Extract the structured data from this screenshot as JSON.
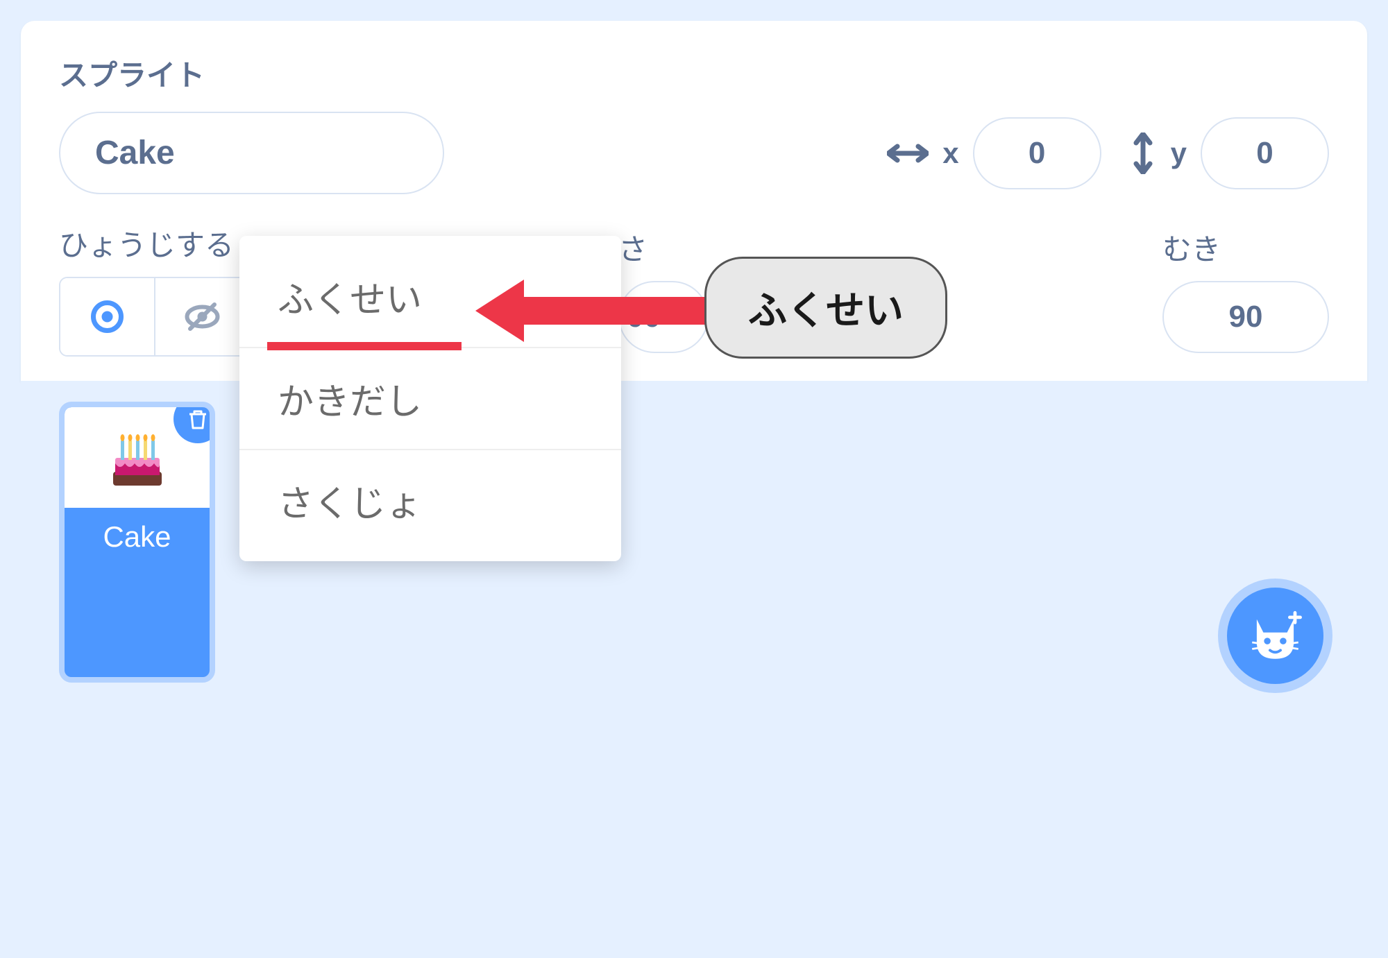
{
  "panel": {
    "sprite_section_label": "スプライト",
    "sprite_name": "Cake",
    "x_label": "x",
    "x_value": "0",
    "y_label": "y",
    "y_value": "0",
    "visibility_label": "ひょうじする",
    "size_label_fragment": "さ",
    "size_value_fragment": "00",
    "direction_label": "むき",
    "direction_value": "90"
  },
  "context_menu": {
    "items": [
      "ふくせい",
      "かきだし",
      "さくじょ"
    ]
  },
  "annotation": {
    "callout_text": "ふくせい"
  },
  "sprite_tile": {
    "name": "Cake"
  },
  "icons": {
    "horizontal_arrow": "↔",
    "vertical_arrow": "↕"
  },
  "colors": {
    "primary": "#4d97ff",
    "accent_red": "#ed3648",
    "text_muted": "#5b6e8f",
    "background": "#e5f0ff"
  }
}
